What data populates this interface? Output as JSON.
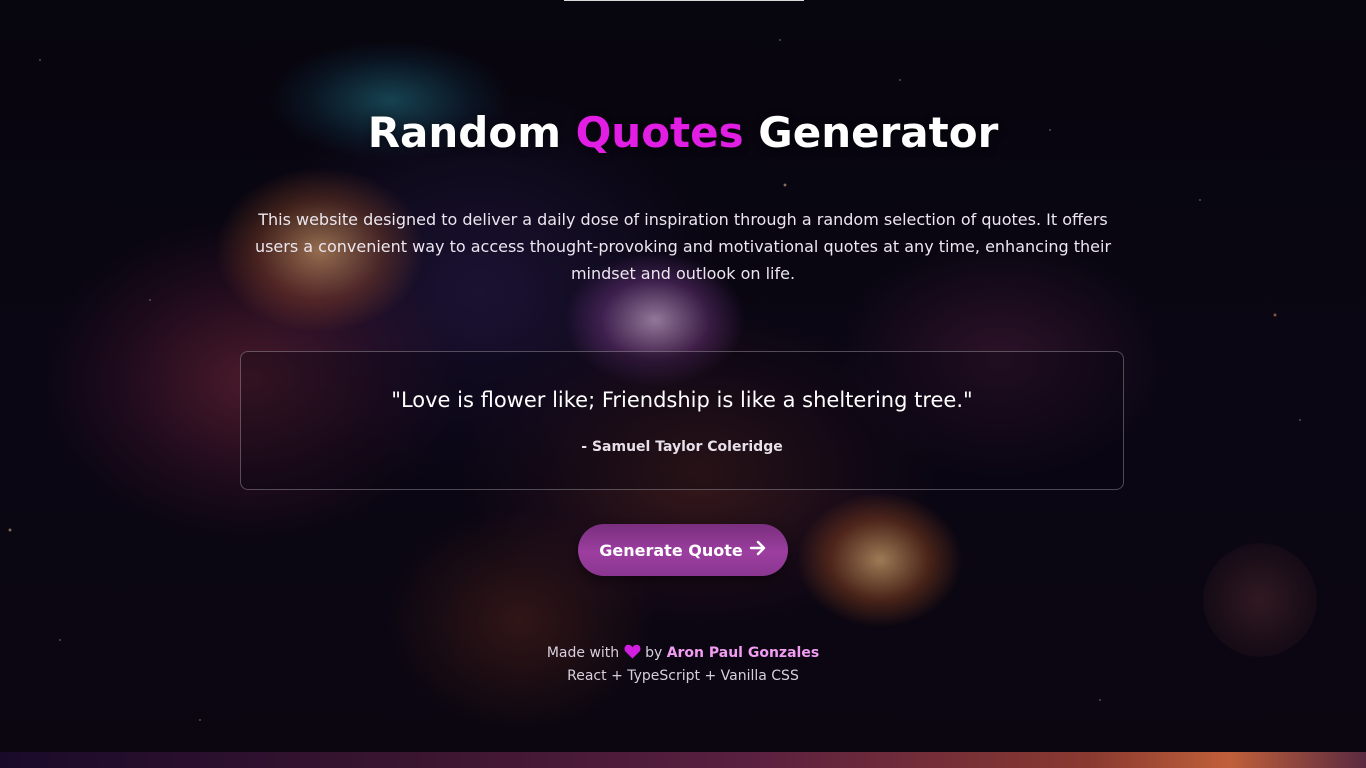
{
  "header": {
    "title_part1": "Random ",
    "title_accent": "Quotes",
    "title_part2": " Generator"
  },
  "description": "This website designed to deliver a daily dose of inspiration through a random selection of quotes. It offers users a convenient way to access thought-provoking and motivational quotes at any time, enhancing their mindset and outlook on life.",
  "quote": {
    "text": "\"Love is flower like; Friendship is like a sheltering tree.\"",
    "author": "- Samuel Taylor Coleridge"
  },
  "button": {
    "label": "Generate Quote",
    "icon": "arrow-right-icon"
  },
  "footer": {
    "made_with": "Made with",
    "heart_icon": "heart-icon",
    "by": "by",
    "author_name": "Aron Paul Gonzales",
    "tech_stack": "React + TypeScript + Vanilla CSS"
  },
  "colors": {
    "accent": "#e21ee4",
    "button": "#8a3690",
    "author_link": "#f29cf2",
    "heart": "#d21ee0"
  }
}
